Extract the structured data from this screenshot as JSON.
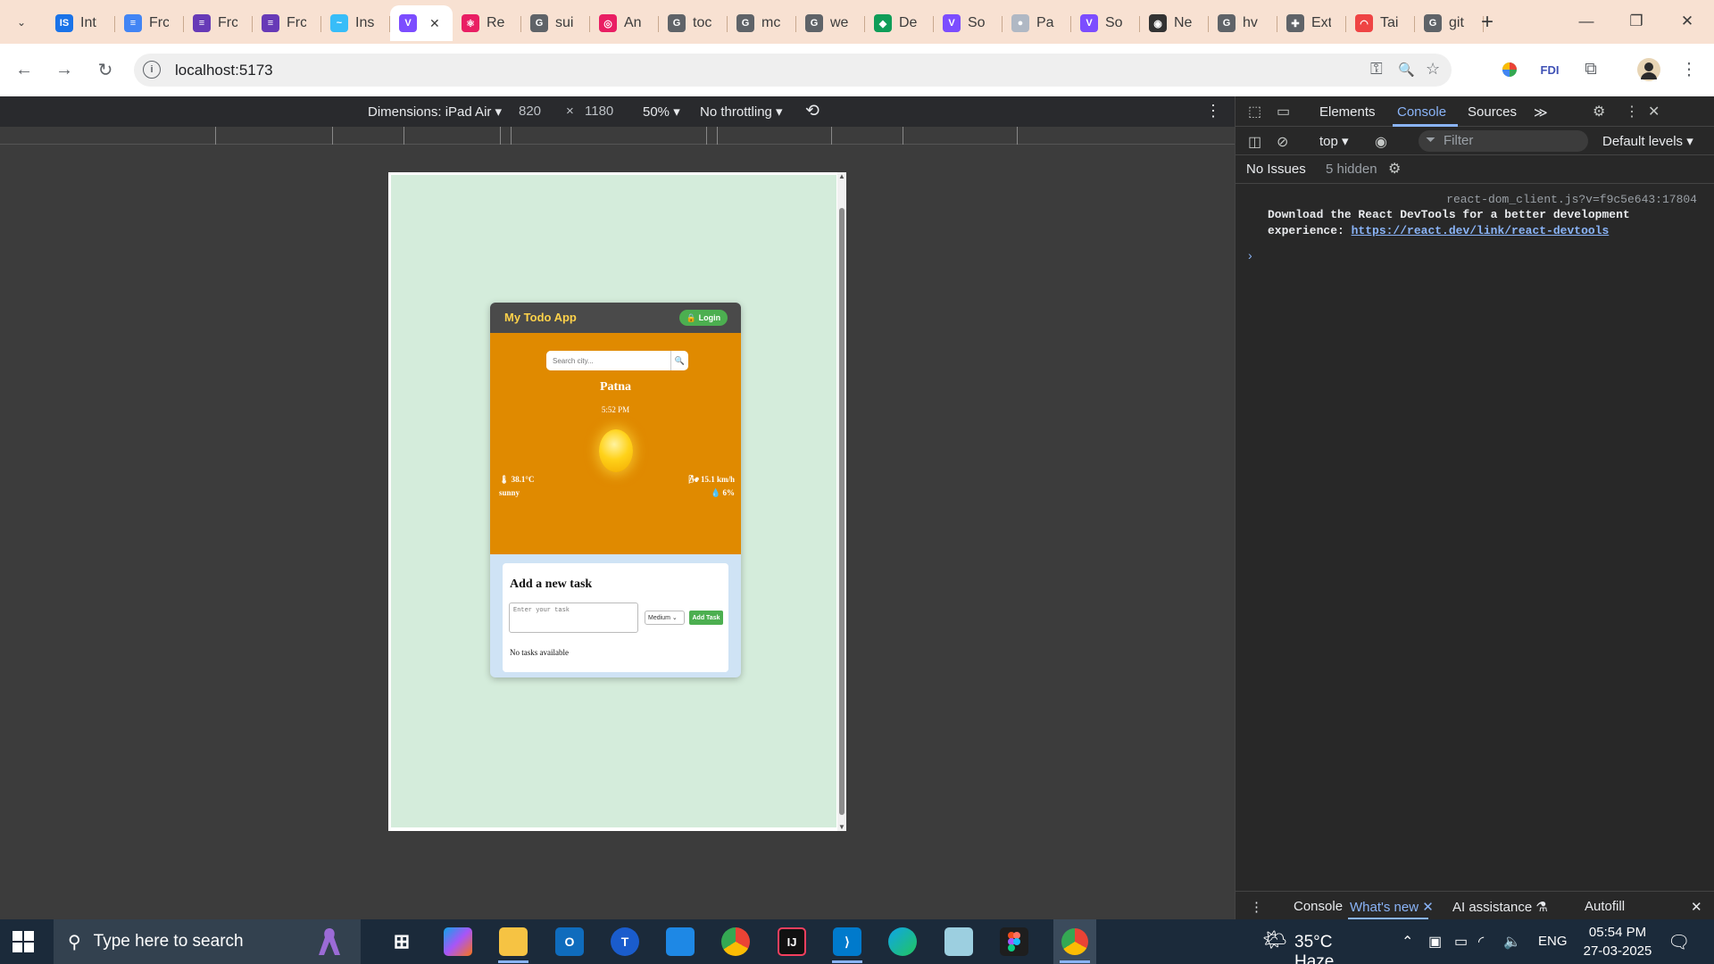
{
  "browser": {
    "tabs": [
      {
        "title": "Int",
        "favicon": "IS",
        "favicon_color": "#1a73e8"
      },
      {
        "title": "Frc",
        "favicon": "≡",
        "favicon_color": "#4285f4"
      },
      {
        "title": "Frc",
        "favicon": "≡",
        "favicon_color": "#673ab7"
      },
      {
        "title": "Frc",
        "favicon": "≡",
        "favicon_color": "#673ab7"
      },
      {
        "title": "Ins",
        "favicon": "~",
        "favicon_color": "#38bdf8"
      },
      {
        "title": "",
        "favicon": "V",
        "favicon_color": "#7c4dff",
        "active": true
      },
      {
        "title": "Re",
        "favicon": "⚛",
        "favicon_color": "#e91e63"
      },
      {
        "title": "sui",
        "favicon": "G",
        "favicon_color": "#5f6368"
      },
      {
        "title": "An",
        "favicon": "◎",
        "favicon_color": "#e91e63"
      },
      {
        "title": "toc",
        "favicon": "G",
        "favicon_color": "#5f6368"
      },
      {
        "title": "mc",
        "favicon": "G",
        "favicon_color": "#5f6368"
      },
      {
        "title": "we",
        "favicon": "G",
        "favicon_color": "#5f6368"
      },
      {
        "title": "De",
        "favicon": "◆",
        "favicon_color": "#0f9d58"
      },
      {
        "title": "So",
        "favicon": "V",
        "favicon_color": "#7c4dff"
      },
      {
        "title": "Pa",
        "favicon": "●",
        "favicon_color": "#b0b8c4"
      },
      {
        "title": "So",
        "favicon": "V",
        "favicon_color": "#7c4dff"
      },
      {
        "title": "Ne",
        "favicon": "◉",
        "favicon_color": "#333333"
      },
      {
        "title": "hv",
        "favicon": "G",
        "favicon_color": "#5f6368"
      },
      {
        "title": "Ext",
        "favicon": "✚",
        "favicon_color": "#5f6368"
      },
      {
        "title": "Tai",
        "favicon": "◠",
        "favicon_color": "#ef4444"
      },
      {
        "title": "git",
        "favicon": "G",
        "favicon_color": "#5f6368"
      }
    ],
    "active_tab_close": "✕",
    "new_tab": "+",
    "window_controls": {
      "minimize": "—",
      "restore": "❐",
      "close": "✕"
    },
    "url": "localhost:5173",
    "info_glyph": "i",
    "nav_glyphs": {
      "back": "←",
      "forward": "→",
      "reload": "↻"
    },
    "omnibox_glyphs": {
      "password": "⚿",
      "zoom": "🔍",
      "bookmark": "☆"
    },
    "toolbar_glyphs": {
      "extensions": "⧉",
      "menu": "⋮",
      "tab_search": "⌄"
    }
  },
  "device_toolbar": {
    "dimensions_label": "Dimensions: iPad Air ▾",
    "width": "820",
    "times": "×",
    "height": "1180",
    "zoom": "50% ▾",
    "throttling": "No throttling ▾",
    "rotate_glyph": "⟲",
    "more_glyph": "⋮"
  },
  "app": {
    "title": "My Todo App",
    "login_label": "🔒 Login",
    "search_placeholder": "Search city...",
    "search_glyph": "🔍",
    "city": "Patna",
    "time": "5:52 PM",
    "temperature": "🌡 38.1°C",
    "wind": "🌬 15.1 km/h",
    "condition": "sunny",
    "humidity": "💧 6%",
    "task_heading": "Add a new task",
    "task_placeholder": "Enter your task",
    "priority_selected": "Medium ⌄",
    "add_task_label": "Add Task",
    "no_tasks": "No tasks available"
  },
  "devtools": {
    "tabs": {
      "elements": "Elements",
      "console": "Console",
      "sources": "Sources",
      "more": "≫"
    },
    "context": "top ▾",
    "filter_placeholder": "Filter",
    "levels": "Default levels ▾",
    "issues": "No Issues",
    "hidden": "5 hidden",
    "message_source": "react-dom_client.js?v=f9c5e643:17804",
    "message_text": "Download the React DevTools for a better development experience: ",
    "message_link": "https://react.dev/link/react-devtools",
    "prompt": "›",
    "drawer": {
      "more": "⋮",
      "console": "Console",
      "whats_new": "What's new ✕",
      "ai": "AI assistance ⚗",
      "autofill": "Autofill",
      "close": "✕"
    }
  },
  "taskbar": {
    "search_text": "Type here to search",
    "weather": "35°C  Haze",
    "language": "ENG",
    "time": "05:54 PM",
    "date": "27-03-2025"
  }
}
